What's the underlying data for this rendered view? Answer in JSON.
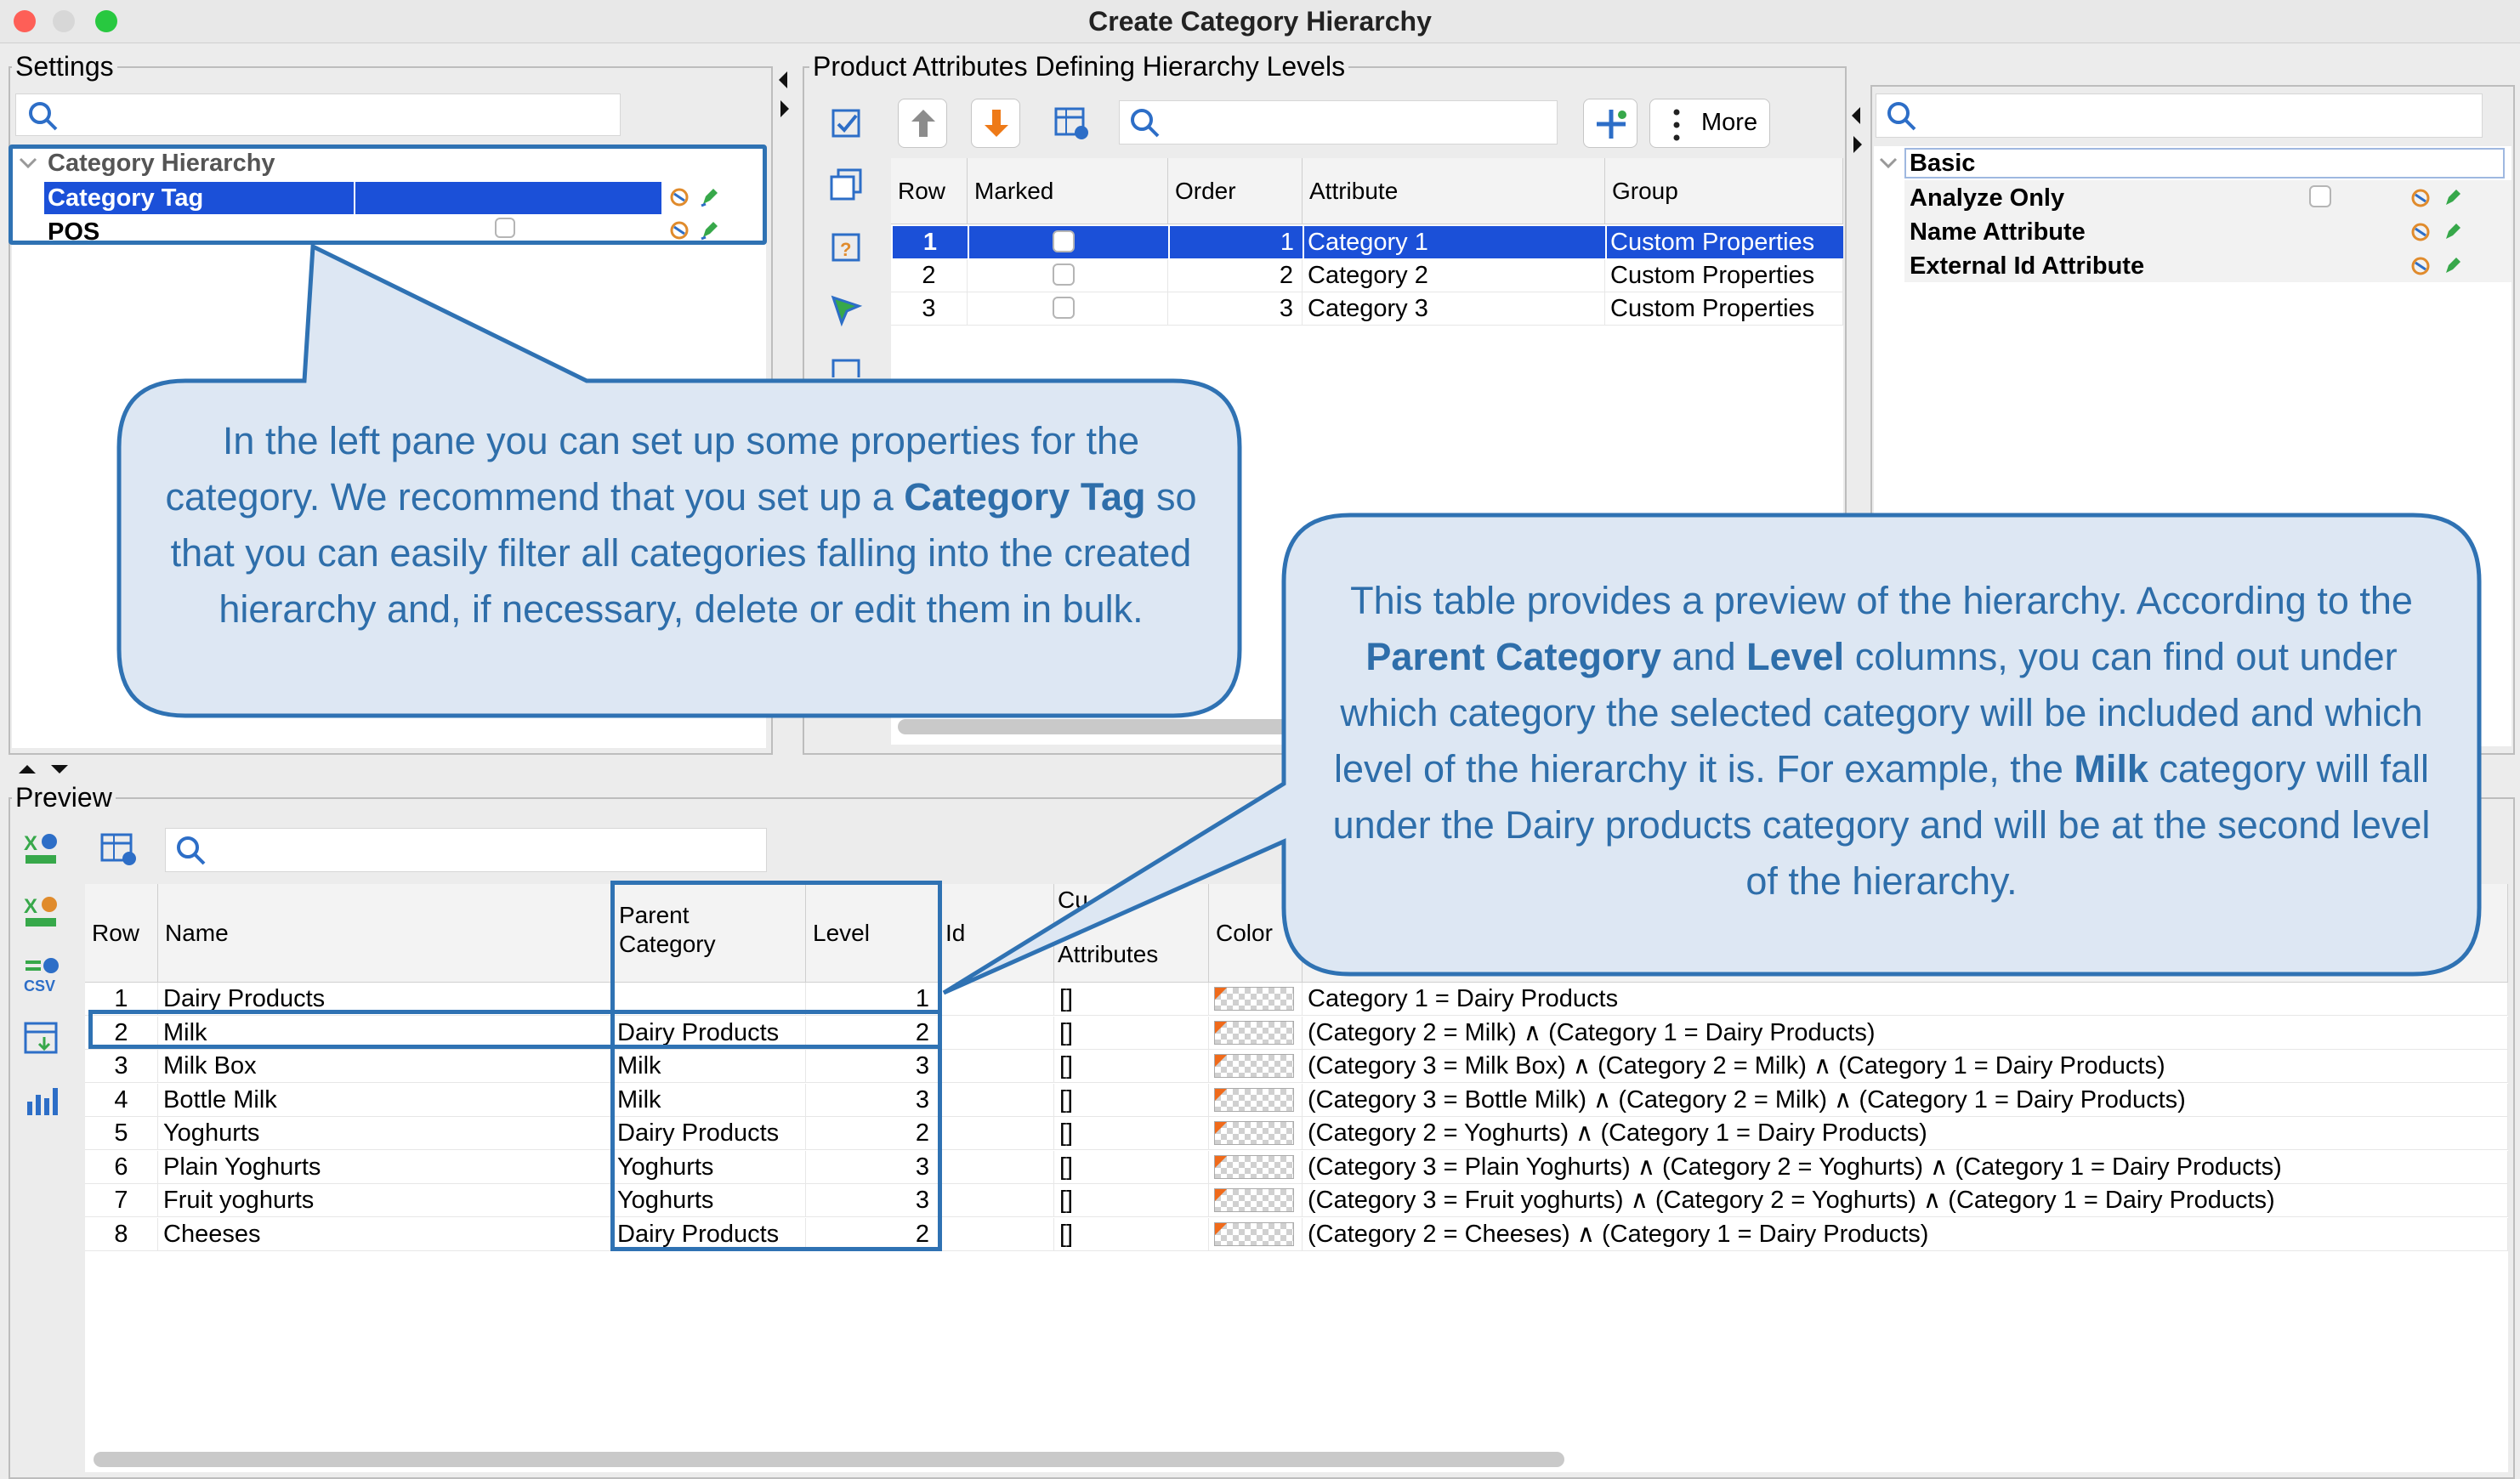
{
  "window": {
    "title": "Create Category Hierarchy"
  },
  "settings": {
    "title": "Settings",
    "tree": {
      "root": "Category Hierarchy",
      "rows": [
        {
          "label": "Category Tag",
          "selected": true
        },
        {
          "label": "POS",
          "selected": false
        }
      ]
    }
  },
  "attributes": {
    "title": "Product Attributes Defining Hierarchy Levels",
    "toolbar": {
      "more_label": "More"
    },
    "columns": [
      "Row",
      "Marked",
      "Order",
      "Attribute",
      "Group"
    ],
    "rows": [
      {
        "row": "1",
        "order": "1",
        "attribute": "Category 1",
        "group": "Custom Properties"
      },
      {
        "row": "2",
        "order": "2",
        "attribute": "Category 2",
        "group": "Custom Properties"
      },
      {
        "row": "3",
        "order": "3",
        "attribute": "Category 3",
        "group": "Custom Properties"
      }
    ]
  },
  "properties": {
    "section": "Basic",
    "rows": [
      "Analyze Only",
      "Name Attribute",
      "External Id Attribute"
    ]
  },
  "preview": {
    "title": "Preview",
    "columns": {
      "row": "Row",
      "name": "Name",
      "parent": "Parent Category",
      "level": "Level",
      "id": "Id",
      "custom": "Custom Attributes",
      "custom_visible": "Attributes",
      "custom_top": "Cu",
      "color": "Color"
    },
    "rows": [
      {
        "row": "1",
        "name": "Dairy Products",
        "parent": "",
        "level": "1",
        "custom": "[]",
        "desc": "Category 1 = Dairy Products"
      },
      {
        "row": "2",
        "name": "Milk",
        "parent": "Dairy Products",
        "level": "2",
        "custom": "[]",
        "desc": "(Category 2 = Milk) ∧ (Category 1 = Dairy Products)"
      },
      {
        "row": "3",
        "name": "Milk Box",
        "parent": "Milk",
        "level": "3",
        "custom": "[]",
        "desc": "(Category 3 = Milk Box) ∧ (Category 2 = Milk) ∧ (Category 1 = Dairy Products)"
      },
      {
        "row": "4",
        "name": "Bottle Milk",
        "parent": "Milk",
        "level": "3",
        "custom": "[]",
        "desc": "(Category 3 = Bottle Milk) ∧ (Category 2 = Milk) ∧ (Category 1 = Dairy Products)"
      },
      {
        "row": "5",
        "name": "Yoghurts",
        "parent": "Dairy Products",
        "level": "2",
        "custom": "[]",
        "desc": "(Category 2 = Yoghurts) ∧ (Category 1 = Dairy Products)"
      },
      {
        "row": "6",
        "name": "Plain Yoghurts",
        "parent": "Yoghurts",
        "level": "3",
        "custom": "[]",
        "desc": "(Category 3 = Plain Yoghurts) ∧ (Category 2 = Yoghurts) ∧ (Category 1 = Dairy Products)"
      },
      {
        "row": "7",
        "name": "Fruit yoghurts",
        "parent": "Yoghurts",
        "level": "3",
        "custom": "[]",
        "desc": "(Category 3 = Fruit yoghurts) ∧ (Category 2 = Yoghurts) ∧ (Category 1 = Dairy Products)"
      },
      {
        "row": "8",
        "name": "Cheeses",
        "parent": "Dairy Products",
        "level": "2",
        "custom": "[]",
        "desc": "(Category 2 = Cheeses) ∧ (Category 1 = Dairy Products)"
      }
    ]
  },
  "callouts": {
    "left": {
      "p1": "In the left pane you can set up some properties for the category. We recommend that you set up a ",
      "b1": "Category Tag",
      "p2": " so that you can easily filter all categories falling into the created hierarchy and, if necessary, delete or edit them in bulk."
    },
    "right": {
      "p1": "This table provides a preview of the hierarchy. According to the ",
      "b1": "Parent Category",
      "p2": " and ",
      "b2": "Level",
      "p3": " columns, you can find out under which category the selected category will be included and which level of the hierarchy it is. For example, the ",
      "b3": "Milk",
      "p4": " category will fall under the Dairy products category and will be at the second level of the hierarchy."
    }
  },
  "colors": {
    "selection": "#1b50d8",
    "callout_border": "#2f72b3",
    "callout_fill": "#dde7f3",
    "callout_text": "#2e6eaa"
  }
}
